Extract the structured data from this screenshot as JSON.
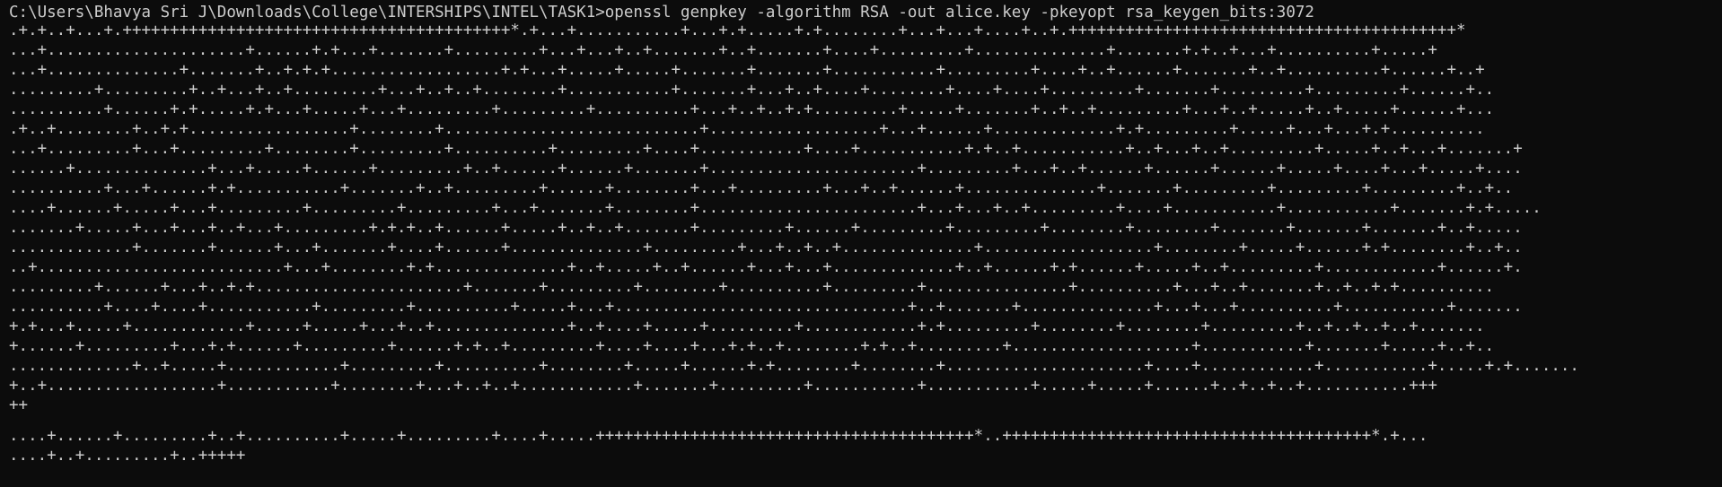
{
  "terminal": {
    "prompt_line": "C:\\Users\\Bhavya Sri J\\Downloads\\College\\INTERSHIPS\\INTEL\\TASK1>openssl genpkey -algorithm RSA -out alice.key -pkeyopt rsa_keygen_bits:3072",
    "output": [
      ".+.+..+...+.+++++++++++++++++++++++++++++++++++++++++*.+...+...........+...+.+.....+.+........+...+...+....+..+.+++++++++++++++++++++++++++++++++++++++++*",
      "...+.....................+......+.+...+.......+.........+...+...+..+.......+..+.......+....+.........+..............+.......+.+..+...+..........+.....+",
      "...+..............+.......+..+.+.+..................+.+...+.....+.....+.......+.......+...........+.........+....+..+......+.......+..+..........+......+..+",
      ".........+.........+..+...+..+.........+...+..+..+........+...........+.......+...+..+....+........+....+....+.........+.......+.........+.........+......+..",
      "..........+......+.+.....+.+...+.....+...+.........+.........+..........+...+..+..+.+.........+.....+.......+..+..+.........+...+..+.....+..+.....+......+...",
      ".+..+........+..+.+.................+........+...........................+..................+...+......+.............+.+.........+.....+...+...+.+..........",
      "...+.........+...+.........+........+.........+..........+.........+....+...........+....+...........+.+..+...........+..+...+..+.........+.....+..+...+.......+",
      "......+..............+...+.....+......+.........+..+......+......+.......+......................+.........+...+..+......+......+......+.....+....+...+.....+....",
      "..........+...+......+.+...........+.......+..+.........+......+........+...+.........+...+..+......+..............+.......+.........+.........+.........+..+..",
      "....+......+.....+...+.........+.........+.........+...+.......+........+.......................+...+...+..+.........+....+...........+...........+.......+.+.....",
      ".......+.....+...+...+..+...+.........+.+.+..+......+.....+..+..+.......+.........+......+.........+.........+........+........+.......+.......+.......+..+.....",
      ".............+.......+......+...+.......+....+......+..............+.........+...+..+..+..............+..................+........+.....+......+.+........+..+..",
      "..+..........................+...+........+.+..............+..+.....+..+......+...+...+.............+..+......+.+......+.....+..+.........+............+......+.",
      ".........+......+...+..+.+......................+.......+.........+........+..........+.........+...............+..........+...+..+.......+..+..+.+..........",
      "..........+....+....+...........+.........+..........+.....+...+...............................+..+.......+..............+...+...+..........+...........+.......",
      "+.+...+.....+............+.....+.....+...+..+..............+..+....+.....+.........+............+.+.........+........+........+.........+..+..+..+..+.......",
      "+......+.........+...+.+......+.........+......+.+..+.........+....+....+...+.+..+........+.+..+.........+...................+...........+.......+.....+..+..",
      ".............+..+.....+............+.........+..........+........+.....+......+.+........+........+.....................+....+............+...........+.....+.+.......",
      "+..+..................+...........+........+...+..+..+............+.......+.........+...........+...........+.....+.....+......+..+..+..+...........+++",
      "++",
      "....+......+.........+..+..........+.....+.........+....+.....++++++++++++++++++++++++++++++++++++++++*..+++++++++++++++++++++++++++++++++++++++*.+...",
      "....+..+.........+..+++++"
    ]
  }
}
